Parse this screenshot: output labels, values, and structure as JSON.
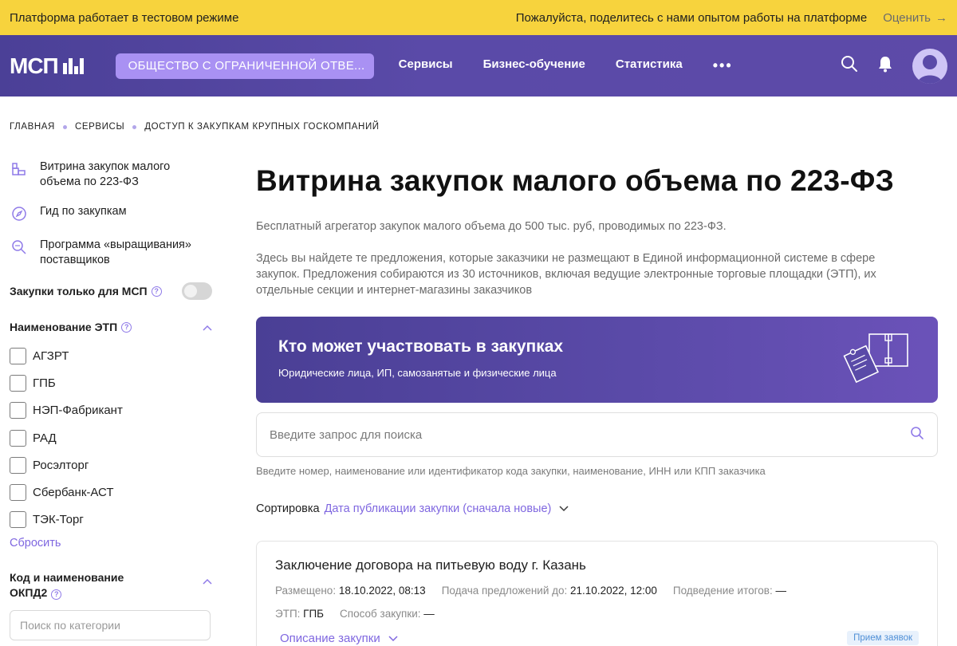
{
  "banner": {
    "left": "Платформа работает в тестовом режиме",
    "right": "Пожалуйста, поделитесь с нами опытом работы на платформе",
    "rate": "Оценить",
    "rate_arrow": "→"
  },
  "header": {
    "logo_text": "МСП",
    "org": "ОБЩЕСТВО С ОГРАНИЧЕННОЙ ОТВЕ...",
    "nav": [
      "Сервисы",
      "Бизнес-обучение",
      "Статистика"
    ],
    "more": "•••",
    "icons": [
      "search-icon",
      "bell-icon",
      "user-avatar-icon"
    ],
    "accent_color": "#5a4aa8"
  },
  "breadcrumb": [
    "ГЛАВНАЯ",
    "СЕРВИСЫ",
    "ДОСТУП К ЗАКУПКАМ КРУПНЫХ ГОСКОМПАНИЙ"
  ],
  "sidebar": {
    "links": [
      {
        "label": "Витрина закупок малого объема по 223-ФЗ",
        "icon": "showcase-icon",
        "active": true
      },
      {
        "label": "Гид по закупкам",
        "icon": "compass-icon",
        "active": false
      },
      {
        "label": "Программа «выращивания» поставщиков",
        "icon": "search-doc-icon",
        "active": false
      }
    ],
    "toggle_label": "Закупки только для МСП",
    "toggle_on": false,
    "etp_title": "Наименование ЭТП",
    "etp_items": [
      "АГЗРТ",
      "ГПБ",
      "НЭП-Фабрикант",
      "РАД",
      "Росэлторг",
      "Сбербанк-АСТ",
      "ТЭК-Торг"
    ],
    "reset": "Сбросить",
    "okpd_title": "Код и наименование ОКПД2",
    "category_placeholder": "Поиск по категории"
  },
  "main": {
    "title": "Витрина закупок малого объема по 223-ФЗ",
    "desc1": "Бесплатный агрегатор закупок малого объема до 500 тыс. руб, проводимых по 223-ФЗ.",
    "desc2": "Здесь вы найдете те предложения, которые заказчики не размещают в Единой информационной системе в сфере закупок. Предложения собираются из 30 источников, включая ведущие электронные торговые площадки (ЭТП), их отдельные секции и интернет-магазины заказчиков",
    "promo_title": "Кто может участвовать в закупках",
    "promo_sub": "Юридические лица, ИП, самозанятые и физические лица",
    "search_placeholder": "Введите запрос для поиска",
    "search_hint": "Введите номер, наименование или идентификатор кода закупки, наименование, ИНН или КПП заказчика",
    "sort_label": "Сортировка",
    "sort_value": "Дата публикации закупки (сначала новые)"
  },
  "card": {
    "title": "Заключение договора на питьевую воду г. Казань",
    "posted_label": "Размещено:",
    "posted_value": "18.10.2022, 08:13",
    "deadline_label": "Подача предложений до:",
    "deadline_value": "21.10.2022, 12:00",
    "results_label": "Подведение итогов:",
    "results_value": "—",
    "etp_label": "ЭТП:",
    "etp_value": "ГПБ",
    "method_label": "Способ закупки:",
    "method_value": "—",
    "more": "Описание закупки",
    "badge": "Прием заявок"
  }
}
